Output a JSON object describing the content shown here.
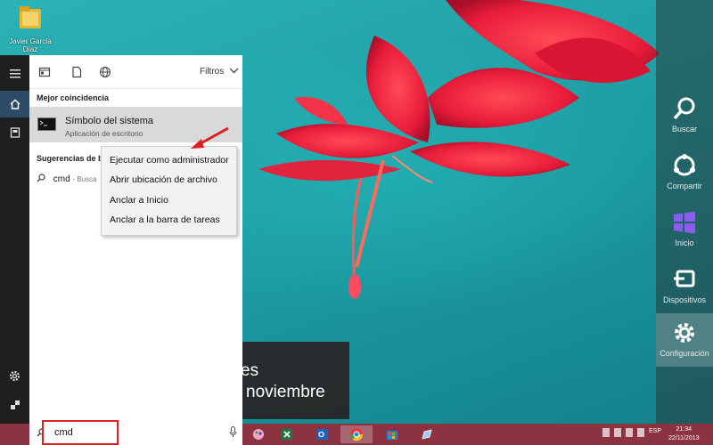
{
  "desktop": {
    "icon_label": "Javier García Díaz",
    "date_line1": "es",
    "date_line2": "noviembre"
  },
  "start_menu": {
    "filter_label": "Filtros",
    "best_match_header": "Mejor coincidencia",
    "best_match_title": "Símbolo del sistema",
    "best_match_subtitle": "Aplicación de escritorio",
    "suggestions_header": "Sugerencias de b",
    "suggestion_text": "cmd",
    "suggestion_hint": "- Busca"
  },
  "context_menu": {
    "items": [
      "Ejecutar como administrador",
      "Abrir ubicación de archivo",
      "Anclar a Inicio",
      "Anclar a la barra de tareas"
    ]
  },
  "search": {
    "value": "cmd"
  },
  "charms": {
    "items": [
      "Buscar",
      "Compartir",
      "Inicio",
      "Dispositivos",
      "Configuración"
    ]
  },
  "taskbar": {
    "time": "21:34",
    "date": "22/11/2013",
    "language": "ESP"
  },
  "colors": {
    "accent_red": "#e02020",
    "taskbar": "#8b3340",
    "rail_active": "#2d4a66"
  }
}
